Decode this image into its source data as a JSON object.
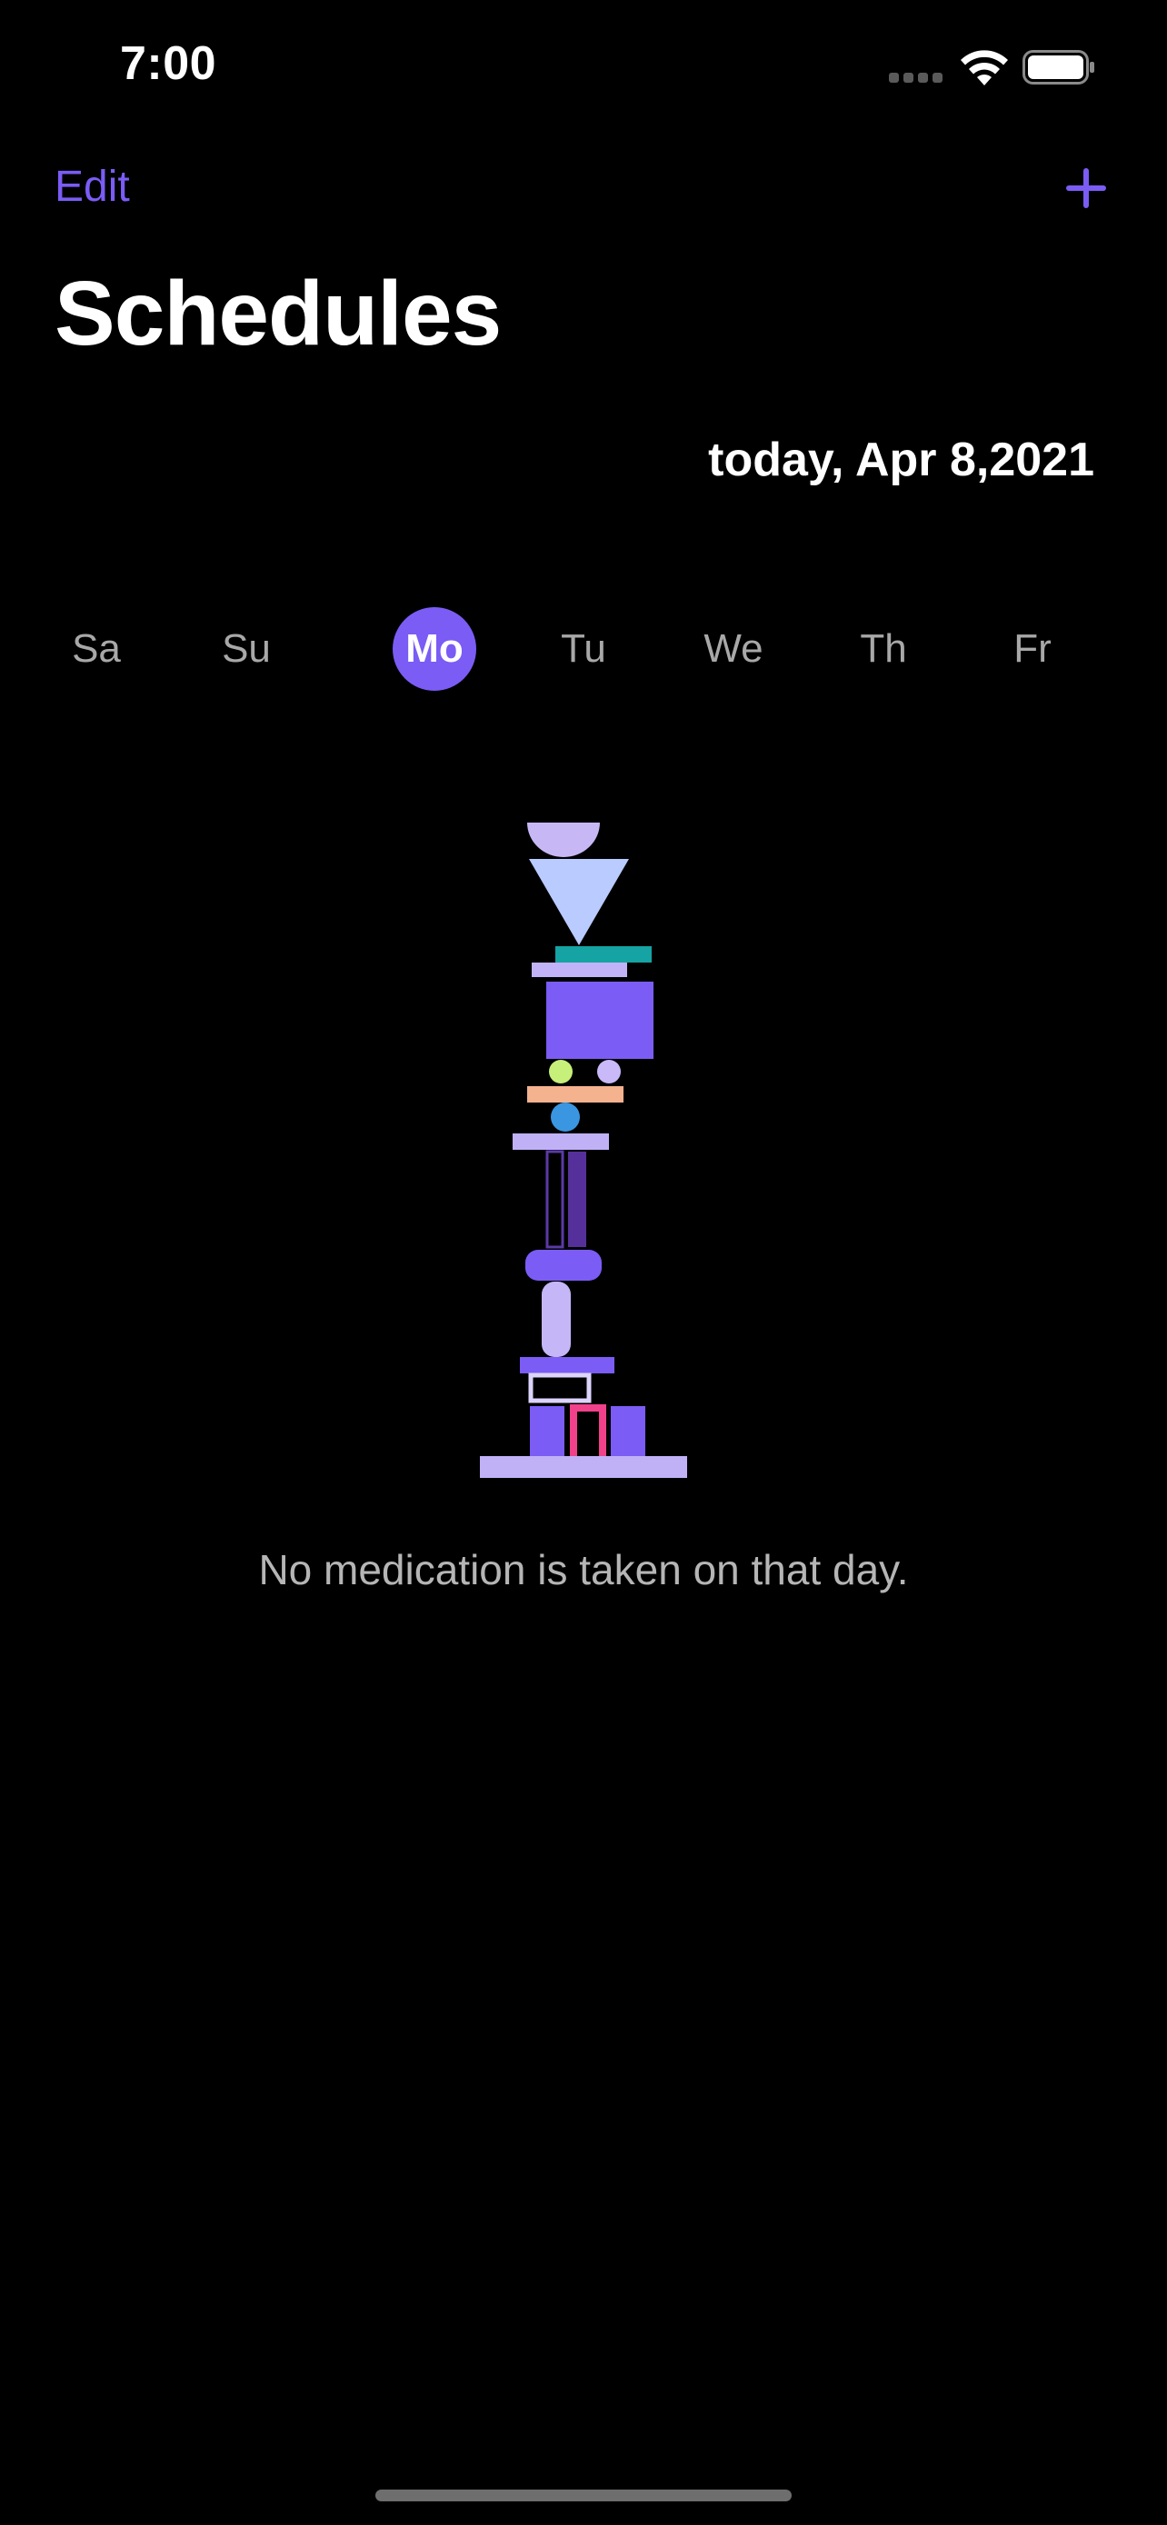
{
  "status_bar": {
    "time": "7:00",
    "icons": [
      "cellular-signal-icon",
      "wifi-icon",
      "battery-icon"
    ]
  },
  "nav": {
    "edit_label": "Edit",
    "add_icon": "plus-icon"
  },
  "title": "Schedules",
  "date_label": "today, Apr 8,2021",
  "week": {
    "days": [
      "Sa",
      "Su",
      "Mo",
      "Tu",
      "We",
      "Th",
      "Fr"
    ],
    "selected": "Mo"
  },
  "empty_state": {
    "illustration": "stacked-shapes-illustration",
    "message": "No medication is taken on that day."
  },
  "colors": {
    "accent": "#7b5cf5",
    "background": "#000000",
    "text_primary": "#ffffff",
    "text_secondary": "#a8a8a8"
  }
}
